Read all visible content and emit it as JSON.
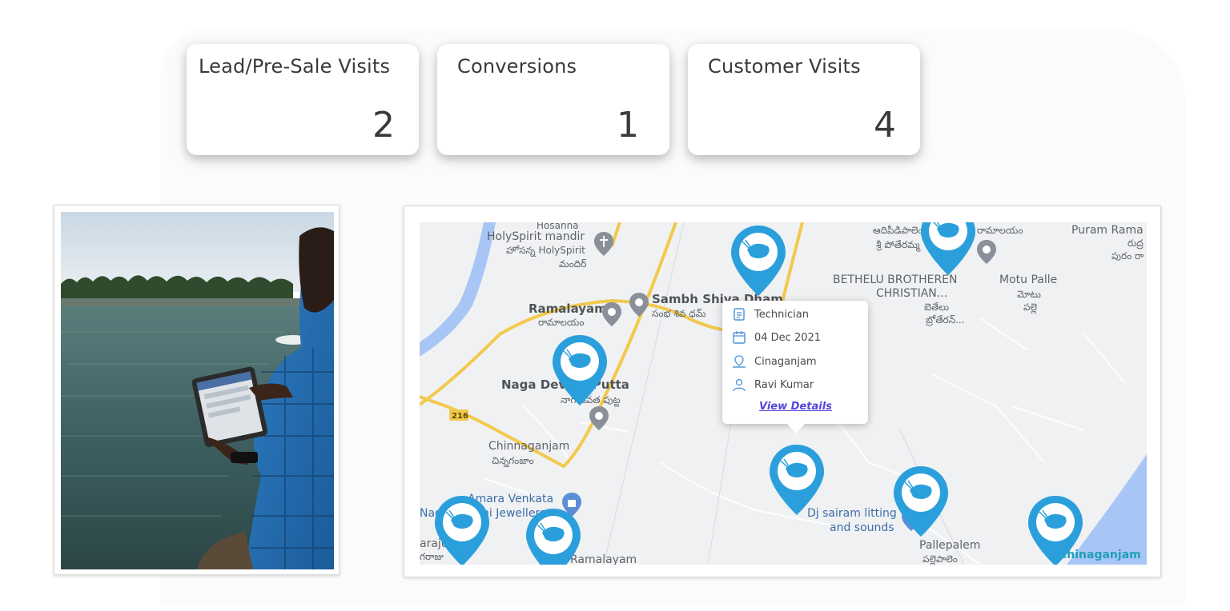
{
  "stats": [
    {
      "label": "Lead/Pre-Sale Visits",
      "value": "2"
    },
    {
      "label": "Conversions",
      "value": "1"
    },
    {
      "label": "Customer Visits",
      "value": "4"
    }
  ],
  "map": {
    "place_labels": {
      "hosanna": "Hosanna",
      "holyspirit": "HolySpirit mandir",
      "holyspirit_te1": "హోసన్న HolySpirit",
      "holyspirit_te2": "మందిర్",
      "ramalayam": "Ramalayam",
      "ramalayam_te": "రామాలయం",
      "sambh": "Sambh Shiva Dham",
      "sambh_te": "సంభ శివ ధమ్",
      "naga": "Naga Devata Putta",
      "naga_te": "నాగ దేవత పుట్ట",
      "road_216": "216",
      "chinnaganjam": "Chinnaganjam",
      "chinnaganjam_te": "చిన్నగంజాం",
      "amara": "Amara Venkata",
      "nagalakshmi": "Nagalakshmi Jewellers",
      "araju": "araju",
      "araju_te": "గరాజు",
      "ramalayam2": "Ramalayam",
      "bethelu": "BETHELU BROTHEREN",
      "christian": "CHRISTIAN...",
      "bethelu_te1": "బెతేలు",
      "bethelu_te2": "బ్రోతేరన్...",
      "adhi": "ఆదిపీడిపాలెం",
      "ramalayam_te2": "రామాలయం",
      "sri": "శ్రీ పోతేరమ్మ",
      "motu": "Motu Palle",
      "motu_te1": "మోటు",
      "motu_te2": "పల్లె",
      "puram": "Puram Rama",
      "puram_te1": "రుద్ర",
      "puram_te2": "పురం రా",
      "dj1": "Dj sairam litting",
      "dj2": "and sounds",
      "pallepalem": "Pallepalem",
      "pallepalem_te": "పల్లెపాలెం",
      "chinaganjam": "Chinaganjam"
    },
    "popup": {
      "role": "Technician",
      "date": "04 Dec 2021",
      "location": "Cinaganjam",
      "person": "Ravi Kumar",
      "link": "View Details"
    },
    "pin_color": "#2a9fdc",
    "road_color": "#f3c843"
  }
}
